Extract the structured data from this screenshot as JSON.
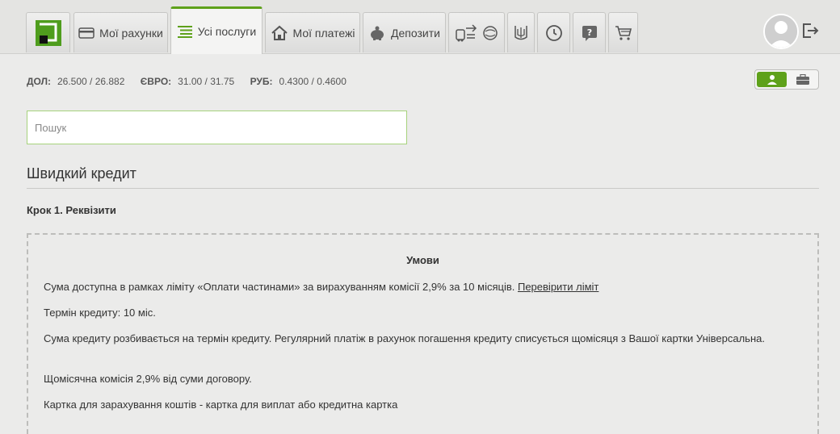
{
  "nav": {
    "tabs": [
      {
        "id": "logo",
        "label": ""
      },
      {
        "id": "accounts",
        "label": "Мої рахунки"
      },
      {
        "id": "services",
        "label": "Усі послуги"
      },
      {
        "id": "payments",
        "label": "Мої платежі"
      },
      {
        "id": "deposits",
        "label": "Депозити"
      }
    ],
    "icon_tabs": [
      "travel-icon",
      "globe-icon",
      "trident-icon",
      "history-icon",
      "help-icon",
      "cart-icon"
    ],
    "accent_color": "#5ea11a"
  },
  "rates": {
    "usd_label": "ДОЛ:",
    "usd_value": "26.500 / 26.882",
    "eur_label": "ЄВРО:",
    "eur_value": "31.00 / 31.75",
    "rub_label": "РУБ:",
    "rub_value": "0.4300 / 0.4600"
  },
  "search": {
    "placeholder": "Пошук"
  },
  "page": {
    "title": "Швидкий кредит",
    "step": "Крок 1. Реквізити"
  },
  "conditions": {
    "title": "Умови",
    "line1": "Сума доступна в рамках ліміту «Оплати частинами» за вирахуванням комісії 2,9% за 10 місяців.",
    "line1_link": "Перевірити ліміт",
    "line2": "Термін кредиту: 10 міс.",
    "line3": "Сума кредиту розбивається на термін кредиту. Регулярний платіж в рахунок погашення кредиту списується щомісяця з Вашої картки Універсальна.",
    "line4": "Щомісячна комісія 2,9% від суми договору.",
    "line5": "Картка для зарахування коштів - картка для виплат або кредитна картка"
  }
}
